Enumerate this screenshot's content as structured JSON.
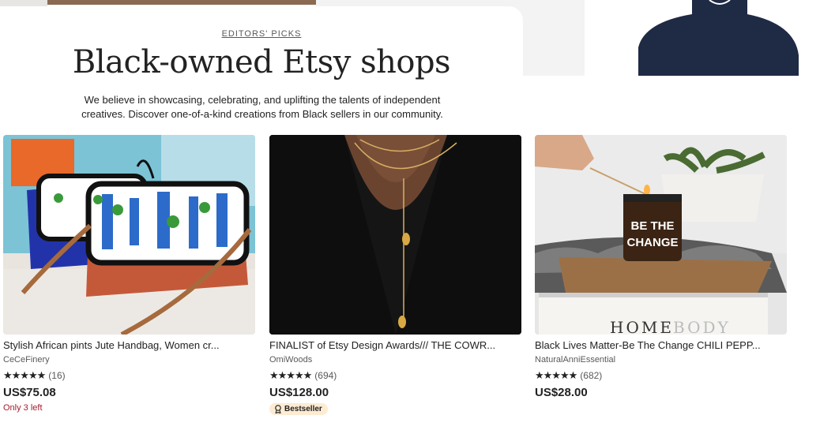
{
  "hero": {
    "eyebrow": "EDITORS' PICKS",
    "title": "Black-owned Etsy shops",
    "description": "We believe in showcasing, celebrating, and uplifting the talents of independent creatives. Discover one-of-a-kind creations from Black sellers in our community."
  },
  "products": [
    {
      "title": "Stylish African pints Jute Handbag, Women cr...",
      "shop": "CeCeFinery",
      "stars": "★★★★★",
      "reviews": "(16)",
      "price": "US$75.08",
      "stock": "Only 3 left"
    },
    {
      "title": "FINALIST of Etsy Design Awards/// THE COWR...",
      "shop": "OmiWoods",
      "stars": "★★★★★",
      "reviews": "(694)",
      "price": "US$128.00",
      "badge": "Bestseller"
    },
    {
      "title": "Black Lives Matter-Be The Change CHILI PEPP...",
      "shop": "NaturalAnniEssential",
      "stars": "★★★★★",
      "reviews": "(682)",
      "price": "US$28.00",
      "candle_label_line1": "BE THE",
      "candle_label_line2": "CHANGE",
      "book_text_dark": "HOME",
      "book_text_light": "BODY"
    }
  ],
  "colors": {
    "stock_warning": "#a61a2e",
    "badge_bg": "#fdebd2",
    "star": "#222222"
  }
}
